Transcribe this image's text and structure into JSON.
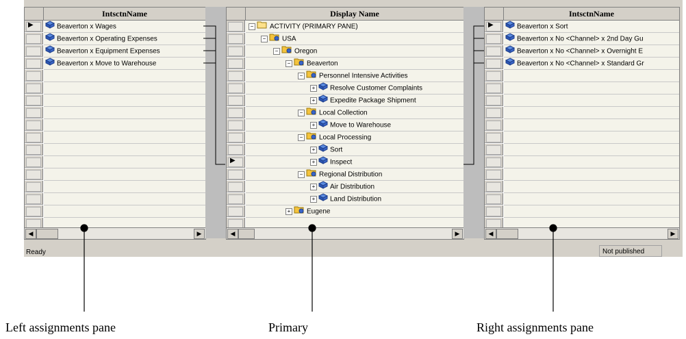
{
  "left_pane": {
    "header": "IntsctnName",
    "rows": [
      "Beaverton x Wages",
      "Beaverton x Operating Expenses",
      "Beaverton x Equipment Expenses",
      "Beaverton x Move to Warehouse"
    ]
  },
  "primary_pane": {
    "header": "Display Name",
    "tree": [
      {
        "label": "ACTIVITY (PRIMARY PANE)",
        "level": 0,
        "icon": "folder-open-icon"
      },
      {
        "label": "USA",
        "level": 1,
        "icon": "folder-icon"
      },
      {
        "label": "Oregon",
        "level": 2,
        "icon": "folder-icon"
      },
      {
        "label": "Beaverton",
        "level": 3,
        "icon": "folder-icon"
      },
      {
        "label": "Personnel Intensive Activities",
        "level": 4,
        "icon": "folder-icon"
      },
      {
        "label": "Resolve Customer Complaints",
        "level": 5,
        "icon": "activity-icon"
      },
      {
        "label": "Expedite Package Shipment",
        "level": 5,
        "icon": "activity-icon"
      },
      {
        "label": "Local Collection",
        "level": 4,
        "icon": "folder-icon"
      },
      {
        "label": "Move to Warehouse",
        "level": 5,
        "icon": "activity-icon"
      },
      {
        "label": "Local Processing",
        "level": 4,
        "icon": "folder-icon"
      },
      {
        "label": "Sort",
        "level": 5,
        "icon": "activity-icon"
      },
      {
        "label": "Inspect",
        "level": 5,
        "icon": "activity-icon"
      },
      {
        "label": "Regional Distribution",
        "level": 4,
        "icon": "folder-icon"
      },
      {
        "label": "Air Distribution",
        "level": 5,
        "icon": "activity-icon"
      },
      {
        "label": "Land Distribution",
        "level": 5,
        "icon": "activity-icon"
      },
      {
        "label": "Eugene",
        "level": 3,
        "icon": "folder-icon"
      }
    ]
  },
  "right_pane": {
    "header": "IntsctnName",
    "rows": [
      "Beaverton x Sort",
      "Beaverton x No <Channel> x 2nd Day Gu",
      "Beaverton x No <Channel> x Overnight E",
      "Beaverton x No <Channel> x Standard Gr"
    ]
  },
  "status": {
    "text": "Ready",
    "publish_state": "Not published"
  },
  "callouts": {
    "left": "Left assignments pane",
    "primary": "Primary",
    "right": "Right assignments pane"
  },
  "colors": {
    "chrome": "#d4d0c8",
    "row_bg": "#f4f3ea",
    "icon_blue": "#3a66c8",
    "folder_yellow": "#f4c33c"
  }
}
